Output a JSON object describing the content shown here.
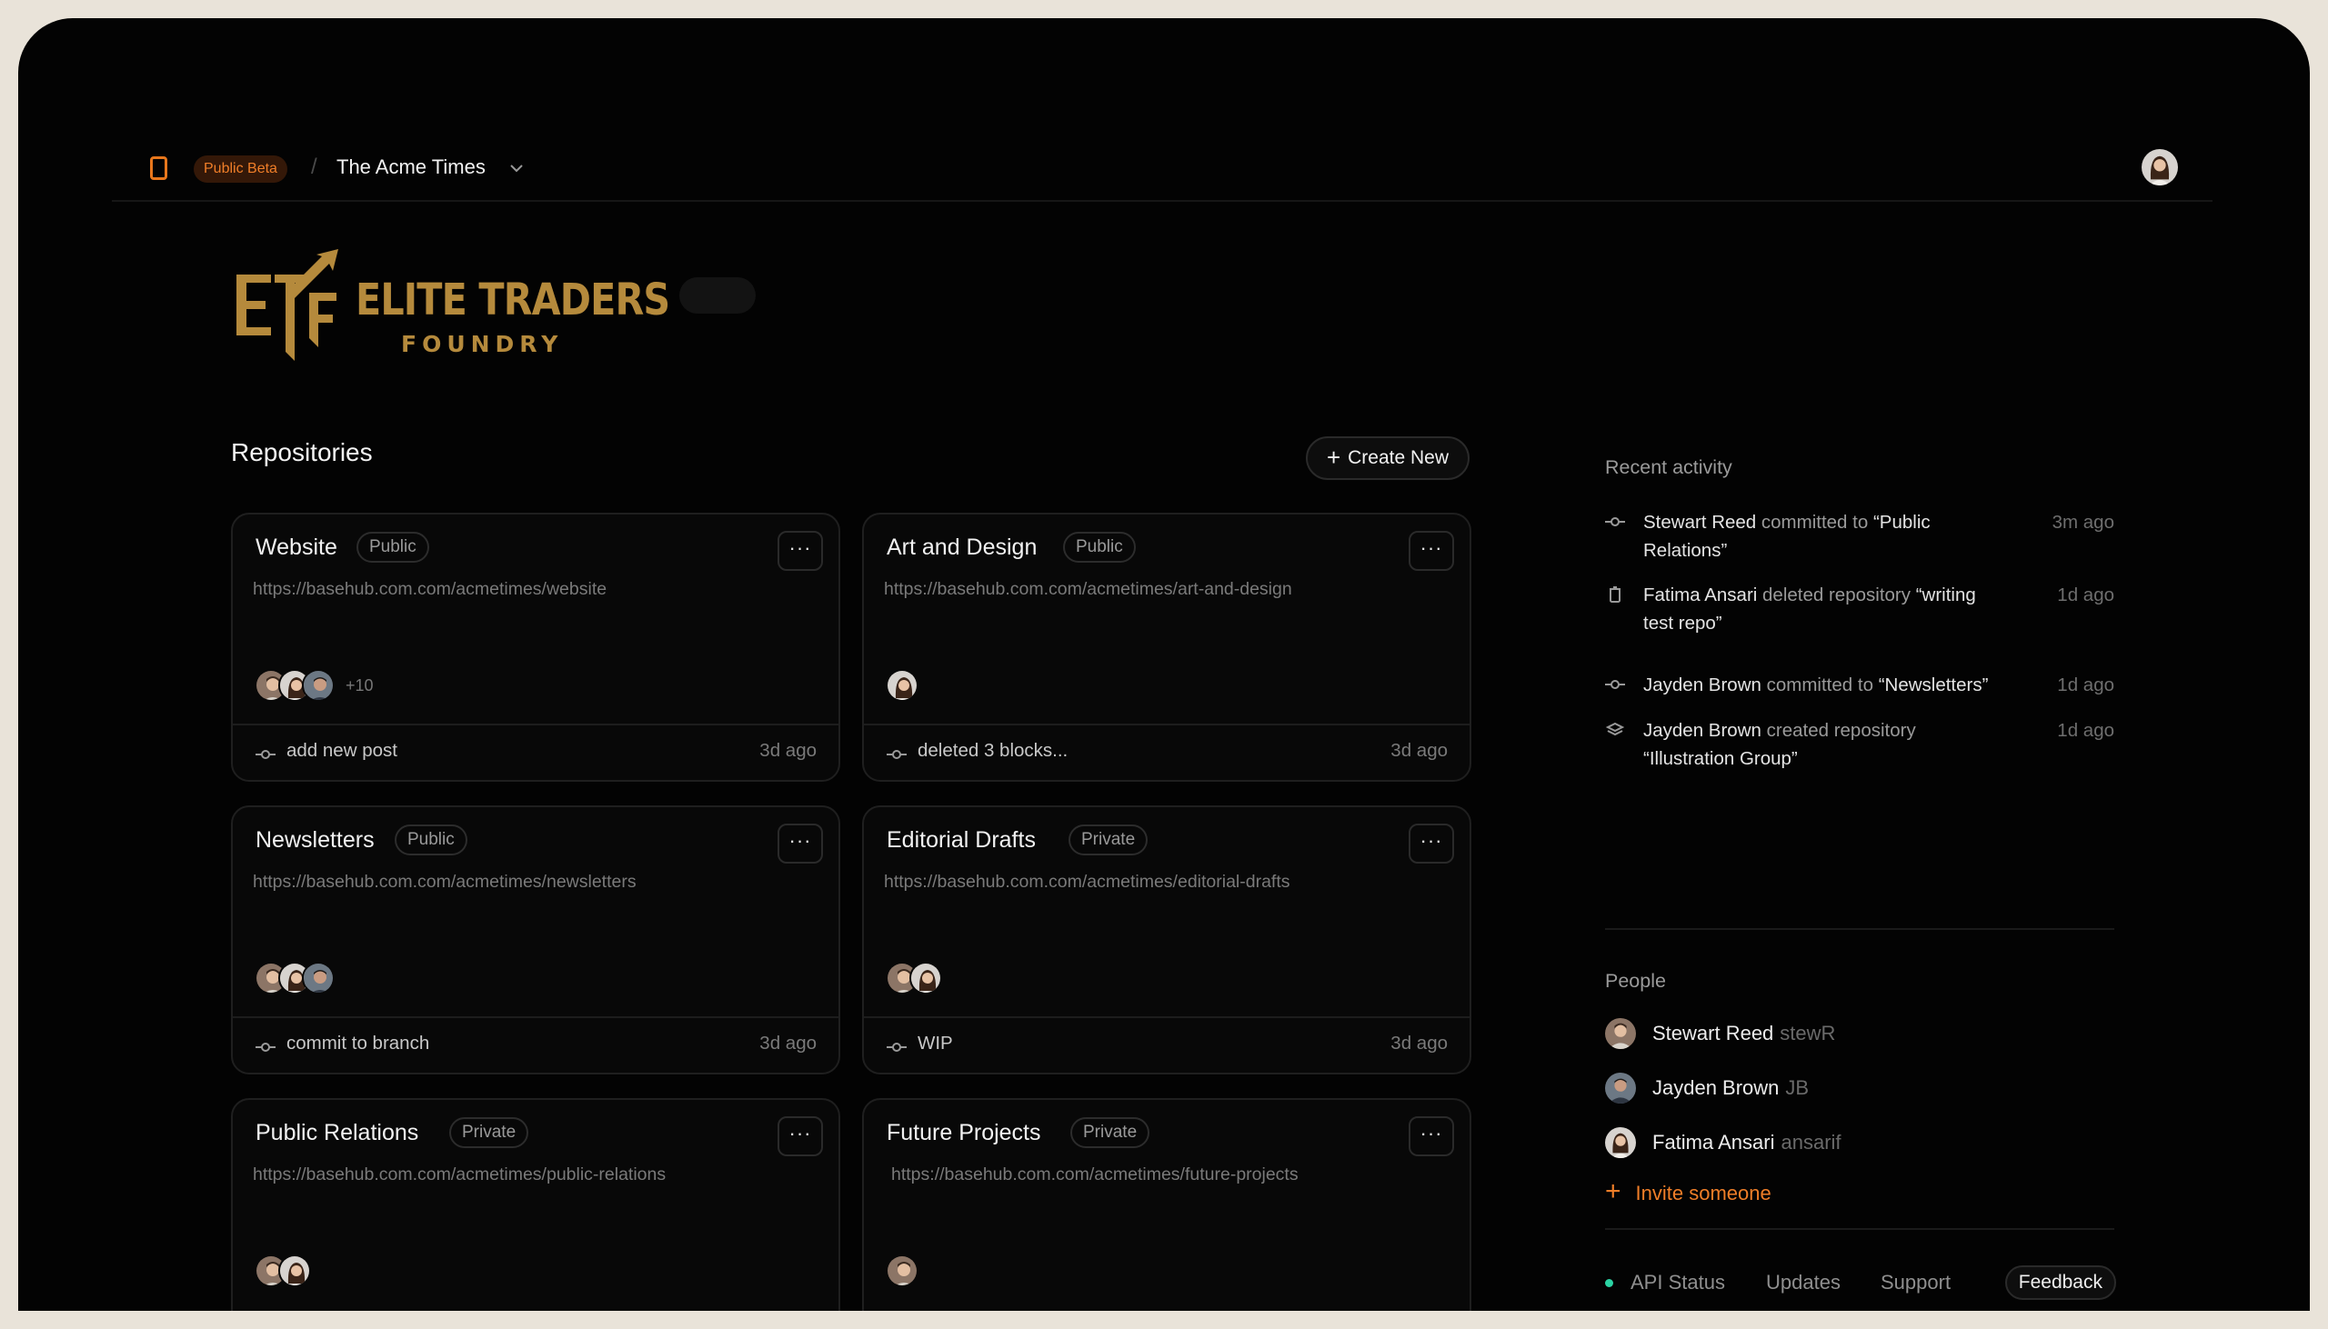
{
  "header": {
    "badge": "Public Beta",
    "separator": "/",
    "org_name": "The Acme Times"
  },
  "logo": {
    "line1": "ELITE TRADERS",
    "line2": "FOUNDRY",
    "monogram": "ETF",
    "color": "#b58a3c"
  },
  "repositories": {
    "title": "Repositories",
    "create_label": "Create New",
    "more_label": "···",
    "cards": [
      {
        "name": "Website",
        "visibility": "Public",
        "url": "https://basehub.com.com/acmetimes/website",
        "extra": "+10",
        "commit": "add new post",
        "time": "3d ago"
      },
      {
        "name": "Art and Design",
        "visibility": "Public",
        "url": "https://basehub.com.com/acmetimes/art-and-design",
        "extra": "",
        "commit": "deleted 3 blocks...",
        "time": "3d ago"
      },
      {
        "name": "Newsletters",
        "visibility": "Public",
        "url": "https://basehub.com.com/acmetimes/newsletters",
        "extra": "",
        "commit": "commit to branch",
        "time": "3d ago"
      },
      {
        "name": "Editorial Drafts",
        "visibility": "Private",
        "url": "https://basehub.com.com/acmetimes/editorial-drafts",
        "extra": "",
        "commit": "WIP",
        "time": "3d ago"
      },
      {
        "name": "Public Relations",
        "visibility": "Private",
        "url": "https://basehub.com.com/acmetimes/public-relations",
        "extra": "",
        "commit": "",
        "time": ""
      },
      {
        "name": "Future Projects",
        "visibility": "Private",
        "url": "https://basehub.com.com/acmetimes/future-projects",
        "extra": "",
        "commit": "",
        "time": ""
      }
    ]
  },
  "recent": {
    "title": "Recent activity",
    "items": [
      {
        "icon": "commit-icon",
        "who": "Stewart Reed",
        "action": "committed to",
        "target": "“Public Relations”",
        "time": "3m ago"
      },
      {
        "icon": "trash-icon",
        "who": "Fatima Ansari",
        "action": "deleted repository",
        "target": "“writing test repo”",
        "time": "1d ago"
      },
      {
        "icon": "commit-icon",
        "who": "Jayden Brown",
        "action": "committed to",
        "target": "“Newsletters”",
        "time": "1d ago"
      },
      {
        "icon": "layers-icon",
        "who": "Jayden Brown",
        "action": "created repository",
        "target": "“Illustration Group”",
        "time": "1d ago"
      }
    ]
  },
  "people": {
    "title": "People",
    "members": [
      {
        "name": "Stewart Reed",
        "handle": "stewR"
      },
      {
        "name": "Jayden Brown",
        "handle": "JB"
      },
      {
        "name": "Fatima Ansari",
        "handle": "ansarif"
      }
    ],
    "invite_label": "Invite someone"
  },
  "footer": {
    "api_status": "API Status",
    "updates": "Updates",
    "support": "Support",
    "feedback": "Feedback"
  },
  "colors": {
    "accent": "#f07e28",
    "status_ok": "#2bd4a4",
    "background": "#030303"
  }
}
